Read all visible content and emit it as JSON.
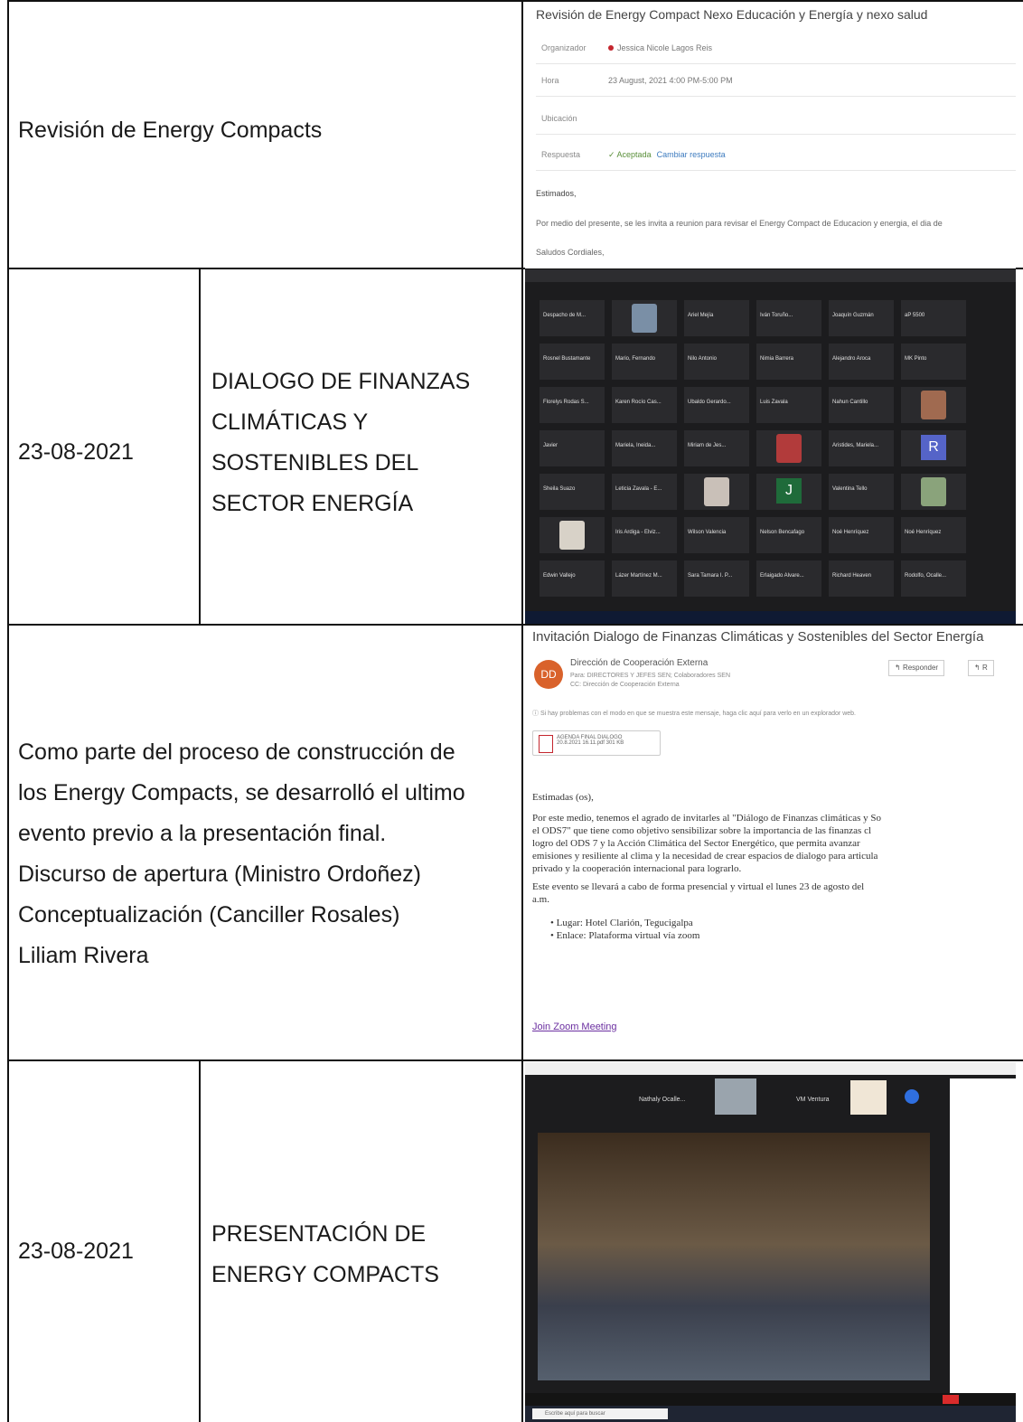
{
  "rows": [
    {
      "title": "Revisión de Energy Compacts",
      "email": {
        "subject": "Revisión de Energy Compact  Nexo Educación y Energía y nexo salud",
        "fields": [
          {
            "label": "Organizador",
            "value": "Jessica Nicole Lagos Reis"
          },
          {
            "label": "Hora",
            "value": "23 August, 2021 4:00 PM-5:00 PM"
          },
          {
            "label": "Ubicación",
            "value": ""
          },
          {
            "label": "Respuesta",
            "value": "Aceptada",
            "link": "Cambiar respuesta"
          }
        ],
        "greeting": "Estimados,",
        "body": "Por medio del presente, se les invita a reunion para revisar el Energy Compact de Educacion y energia, el dia de",
        "closing": "Saludos Cordiales,"
      }
    },
    {
      "date": "23-08-2021",
      "title_lines": [
        "DIALOGO DE FINANZAS",
        "CLIMÁTICAS Y",
        "SOSTENIBLES DEL",
        "SECTOR ENERGÍA"
      ],
      "zoom_grid": {
        "tiles": [
          {
            "name": "Despacho de M..."
          },
          {
            "name": "",
            "photo": true,
            "color": "#7a8fa6"
          },
          {
            "name": "Ariel Mejía"
          },
          {
            "name": "Iván Toruño..."
          },
          {
            "name": "Joaquín Guzmán"
          },
          {
            "name": "aP 5500"
          },
          {
            "name": "Rosnel Bustamante"
          },
          {
            "name": "Mario, Fernando"
          },
          {
            "name": "Nilo Antonio"
          },
          {
            "name": "Nimia Barrera"
          },
          {
            "name": "Alejandro Aroca"
          },
          {
            "name": "MK Pinto"
          },
          {
            "name": "Florelys Rodas S..."
          },
          {
            "name": "Karen Rocío Cas..."
          },
          {
            "name": "Ubaldo Gerardo..."
          },
          {
            "name": "Luis Zavala"
          },
          {
            "name": "Nahun Cantillo"
          },
          {
            "name": "",
            "photo": true,
            "color": "#a06a50"
          },
          {
            "name": "Javier"
          },
          {
            "name": "Mariela, Ineida..."
          },
          {
            "name": "Miriam de Jes..."
          },
          {
            "name": "",
            "photo": true,
            "color": "#b23b3b"
          },
          {
            "name": "Aristides, Mariela..."
          },
          {
            "name": "",
            "letter": "R",
            "color": "#5564c8"
          },
          {
            "name": "Sheila Suazo"
          },
          {
            "name": "Leticia Zavala - E..."
          },
          {
            "name": "",
            "photo": true,
            "color": "#c9c0b8"
          },
          {
            "name": "",
            "letter": "J",
            "color": "#1f6b3a"
          },
          {
            "name": "Valentina Tello"
          },
          {
            "name": "",
            "photo": true,
            "color": "#8aa37b"
          },
          {
            "name": "",
            "photo": true,
            "color": "#d8d2c8"
          },
          {
            "name": "Iris Ardiga - Elviz..."
          },
          {
            "name": "Wilson Valencia"
          },
          {
            "name": "Nelson Bencafago"
          },
          {
            "name": "Noé Henríquez"
          },
          {
            "name": "Noé Henríquez"
          },
          {
            "name": "Edwin Vallejo"
          },
          {
            "name": "Lázer Martínez M..."
          },
          {
            "name": "Sara Tamara I. P..."
          },
          {
            "name": "Erlaigado Alvare..."
          },
          {
            "name": "Richard Heaven"
          },
          {
            "name": "Rodolfo, Ocalle..."
          }
        ]
      }
    },
    {
      "description_lines": [
        "Como parte del proceso de construcción de",
        "los Energy Compacts, se desarrolló el ultimo",
        "evento previo a la presentación final.",
        "Discurso de apertura (Ministro Ordoñez)",
        "Conceptualización (Canciller Rosales)",
        "Liliam Rivera"
      ],
      "email": {
        "subject": "Invitación Dialogo de Finanzas Climáticas y Sostenibles del Sector Energía",
        "avatar": "DD",
        "sender": "Dirección de Cooperación Externa",
        "to_line": "Para:  DIRECTORES Y JEFES SEN;  Colaboradores SEN",
        "cc_line": "CC:   Dirección de Cooperación Externa",
        "notice": "Si hay problemas con el modo en que se muestra este mensaje, haga clic aquí para verlo en un explorador web.",
        "reply_label": "Responder",
        "reply_all_label": "R",
        "attachment": "AGENDA FINAL DIALOGO 20.8.2021 16.11.pdf 301 KB",
        "greeting": "Estimadas (os),",
        "paragraph1_lines": [
          "Por este medio, tenemos el agrado de invitarles al \"Diálogo de Finanzas climáticas y So",
          "el ODS7\" que tiene como objetivo sensibilizar sobre la importancia de las finanzas cl",
          "logro del ODS 7 y la Acción Climática del Sector Energético, que permita avanzar",
          "emisiones y resiliente al clima y la necesidad de crear espacios de dialogo para articula",
          "privado y la cooperación internacional para lograrlo."
        ],
        "paragraph2_lines": [
          "Este evento se llevará a cabo de forma presencial y virtual el lunes 23 de agosto del",
          "a.m."
        ],
        "bullets": [
          "Lugar: Hotel Clarión, Tegucigalpa",
          "Enlace: Plataforma virtual vía zoom"
        ],
        "zoom_link": "Join Zoom Meeting"
      }
    },
    {
      "date": "23-08-2021",
      "title_lines": [
        "PRESENTACIÓN DE",
        "ENERGY COMPACTS"
      ],
      "zoom_room": {
        "participants": [
          "Nathaly Ocalle...",
          "VM Ventura"
        ],
        "search_placeholder": "Escribe aquí para buscar"
      }
    }
  ],
  "colors": {
    "zoom_bg": "#1c1c1e",
    "grid_line": "#111111",
    "text": "#1a1a1a",
    "link": "#3d7bbf",
    "avatar": "#d9622b"
  }
}
